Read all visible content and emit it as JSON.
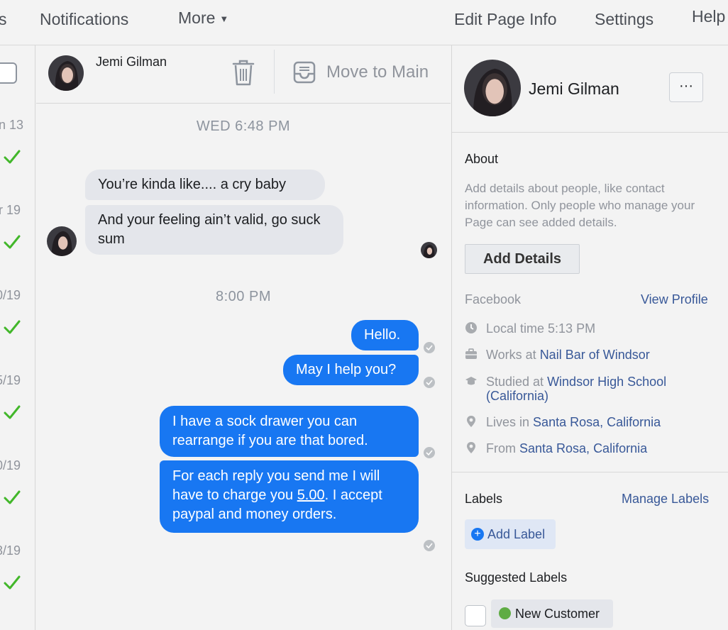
{
  "topnav": {
    "partial_left": "s",
    "notifications": "Notifications",
    "more": "More",
    "edit_page_info": "Edit Page Info",
    "settings": "Settings",
    "help": "Help"
  },
  "inbox_list": {
    "dates": [
      "n 13",
      "r 19",
      "0/19",
      "5/19",
      "0/19",
      "3/19"
    ]
  },
  "conversation": {
    "contact_name": "Jemi Gilman",
    "move_to_main": "Move to Main"
  },
  "messages": {
    "timestamp_1": "WED 6:48 PM",
    "received_1": "You’re kinda like.... a cry baby",
    "received_2": "And your feeling ain’t valid, go suck sum",
    "timestamp_2": "8:00 PM",
    "sent_1": "Hello.",
    "sent_2": "May I help you?",
    "sent_3": "I have a sock drawer you can rearrange if you are that bored.",
    "sent_4_before": "For each reply you send me I will have to charge you ",
    "sent_4_amount": "5.00",
    "sent_4_after": ". I accept paypal and money orders."
  },
  "profile": {
    "name": "Jemi Gilman",
    "more_button": "···",
    "about_heading": "About",
    "about_desc": "Add details about people, like contact information. Only people who manage your Page can see added details.",
    "add_details": "Add Details",
    "facebook_label": "Facebook",
    "view_profile": "View Profile",
    "local_time": "Local time 5:13 PM",
    "works_prefix": "Works at ",
    "works_at": "Nail Bar of Windsor",
    "studied_prefix": "Studied at ",
    "studied_at": "Windsor High School (California)",
    "lives_prefix": "Lives in ",
    "lives_in": "Santa Rosa, California",
    "from_prefix": "From ",
    "from": "Santa Rosa, California",
    "labels_heading": "Labels",
    "manage_labels": "Manage Labels",
    "add_label": "Add Label",
    "suggested_heading": "Suggested Labels",
    "suggested_label": "New Customer"
  },
  "colors": {
    "messenger_blue": "#1877f2",
    "link_blue": "#385898",
    "check_green": "#42b72a",
    "label_green": "#5fac44"
  }
}
